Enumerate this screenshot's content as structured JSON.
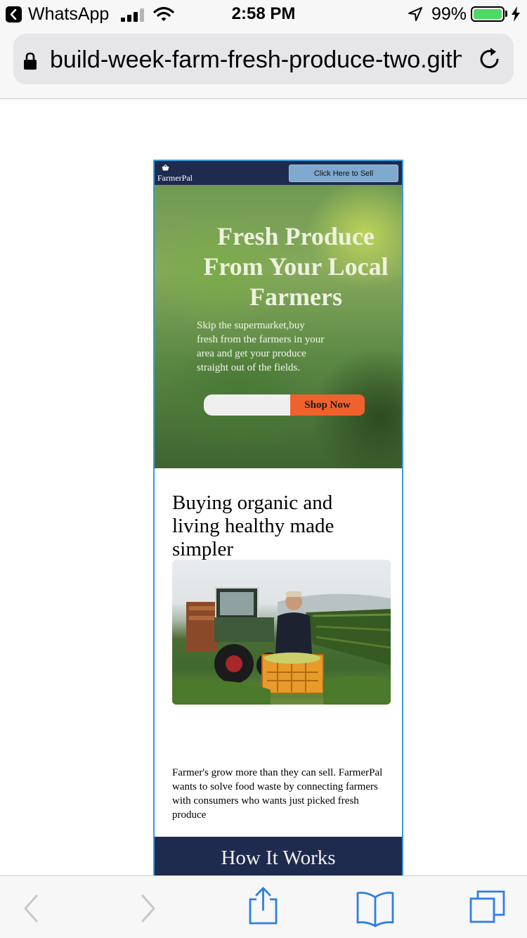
{
  "status_bar": {
    "back_app": "WhatsApp",
    "time": "2:58 PM",
    "battery": "99%"
  },
  "browser": {
    "url": "build-week-farm-fresh-produce-two.github.io"
  },
  "site": {
    "logo_text": "FarmerPal",
    "sell_button": "Click Here to Sell",
    "hero_title": "Fresh Produce From Your Local Farmers",
    "hero_subtitle": "Skip the supermarket,buy fresh from the farmers in your area and get your produce straight out of the fields.",
    "email_placeholder": "",
    "shop_button": "Shop Now",
    "about_heading": "Buying organic and living healthy made simpler",
    "about_text": "Farmer's grow more than they can sell. FarmerPal wants to solve food waste by connecting farmers with consumers who wants just picked fresh produce",
    "how_title": "How It Works"
  },
  "colors": {
    "nav_bg": "#1f2a4f",
    "sell_button_bg": "#7fa9cf",
    "shop_button_bg": "#f0622d",
    "frame_border": "#3a9bd9",
    "safari_blue": "#2f7fe0",
    "battery_green": "#4cd964"
  },
  "icons": {
    "status": [
      "back-arrow-icon",
      "signal-icon",
      "wifi-icon",
      "location-arrow-icon",
      "battery-icon",
      "charging-bolt-icon"
    ],
    "url_bar": [
      "lock-icon",
      "reload-icon"
    ],
    "toolbar": [
      "back-chevron-icon",
      "forward-chevron-icon",
      "share-icon",
      "bookmarks-icon",
      "tabs-icon"
    ]
  }
}
